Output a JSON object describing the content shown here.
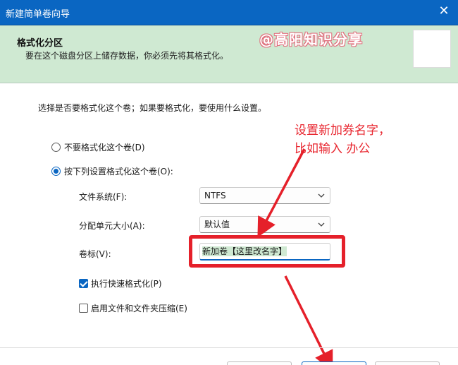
{
  "window": {
    "title": "新建简单卷向导",
    "close_glyph": "✕"
  },
  "header": {
    "title": "格式化分区",
    "subtitle": "要在这个磁盘分区上储存数据，你必须先将其格式化。",
    "watermark": "@高阳知识分享"
  },
  "instruction": "选择是否要格式化这个卷；如果要格式化，要使用什么设置。",
  "radio_options": [
    {
      "label": "不要格式化这个卷(D)",
      "checked": false
    },
    {
      "label": "按下列设置格式化这个卷(O):",
      "checked": true
    }
  ],
  "fields": {
    "filesystem": {
      "label": "文件系统(F):",
      "value": "NTFS"
    },
    "alloc_unit": {
      "label": "分配单元大小(A):",
      "value": "默认值"
    },
    "volume_label": {
      "label": "卷标(V):",
      "value": "新加卷【这里改名字】"
    }
  },
  "checkboxes": [
    {
      "label": "执行快速格式化(P)",
      "checked": true
    },
    {
      "label": "启用文件和文件夹压缩(E)",
      "checked": false
    }
  ],
  "annotation": {
    "line1": "设置新加券名字，",
    "line2": "比如输入  办公",
    "color": "#e5202a"
  },
  "colors": {
    "accent": "#0a66c2",
    "header_bg": "#cfe9d2"
  }
}
